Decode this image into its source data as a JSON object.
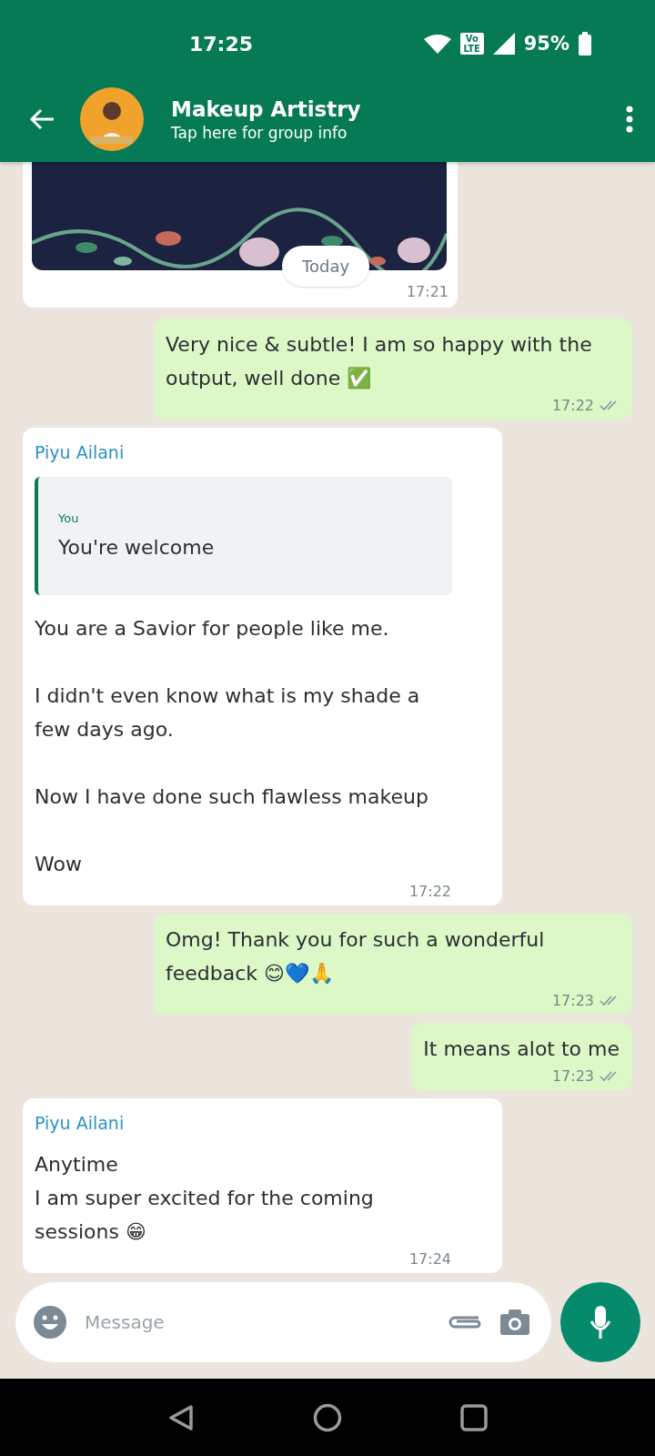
{
  "status_bar": {
    "time": "17:25",
    "network": "Vo LTE",
    "battery": "95%"
  },
  "header": {
    "title": "Makeup Artistry",
    "subtitle": "Tap here for group info"
  },
  "messages": [
    {
      "kind": "picture",
      "date_chip": "Today",
      "time": "17:21"
    },
    {
      "kind": "out",
      "paragraphs": [
        "Very nice & subtle! I am so happy with the output, well done ✅"
      ],
      "time": "17:22",
      "read": false
    },
    {
      "kind": "in",
      "sender": "Piyu Ailani",
      "quote": {
        "author": "You",
        "text": "You're welcome"
      },
      "paragraphs": [
        "You are a Savior for people like me.",
        "I didn't even know what is my shade a few days ago.",
        "Now I have done such flawless makeup",
        "Wow"
      ],
      "time": "17:22"
    },
    {
      "kind": "out",
      "paragraphs": [
        "Omg! Thank you for such a wonderful feedback 😊💙🙏"
      ],
      "time": "17:23",
      "read": false
    },
    {
      "kind": "out",
      "paragraphs": [
        "It means alot to me"
      ],
      "time": "17:23",
      "read": false
    },
    {
      "kind": "in",
      "sender": "Piyu Ailani",
      "paragraphs": [
        "Anytime\nI am super excited for the coming sessions 😁"
      ],
      "time": "17:24"
    }
  ],
  "composer": {
    "placeholder": "Message"
  }
}
